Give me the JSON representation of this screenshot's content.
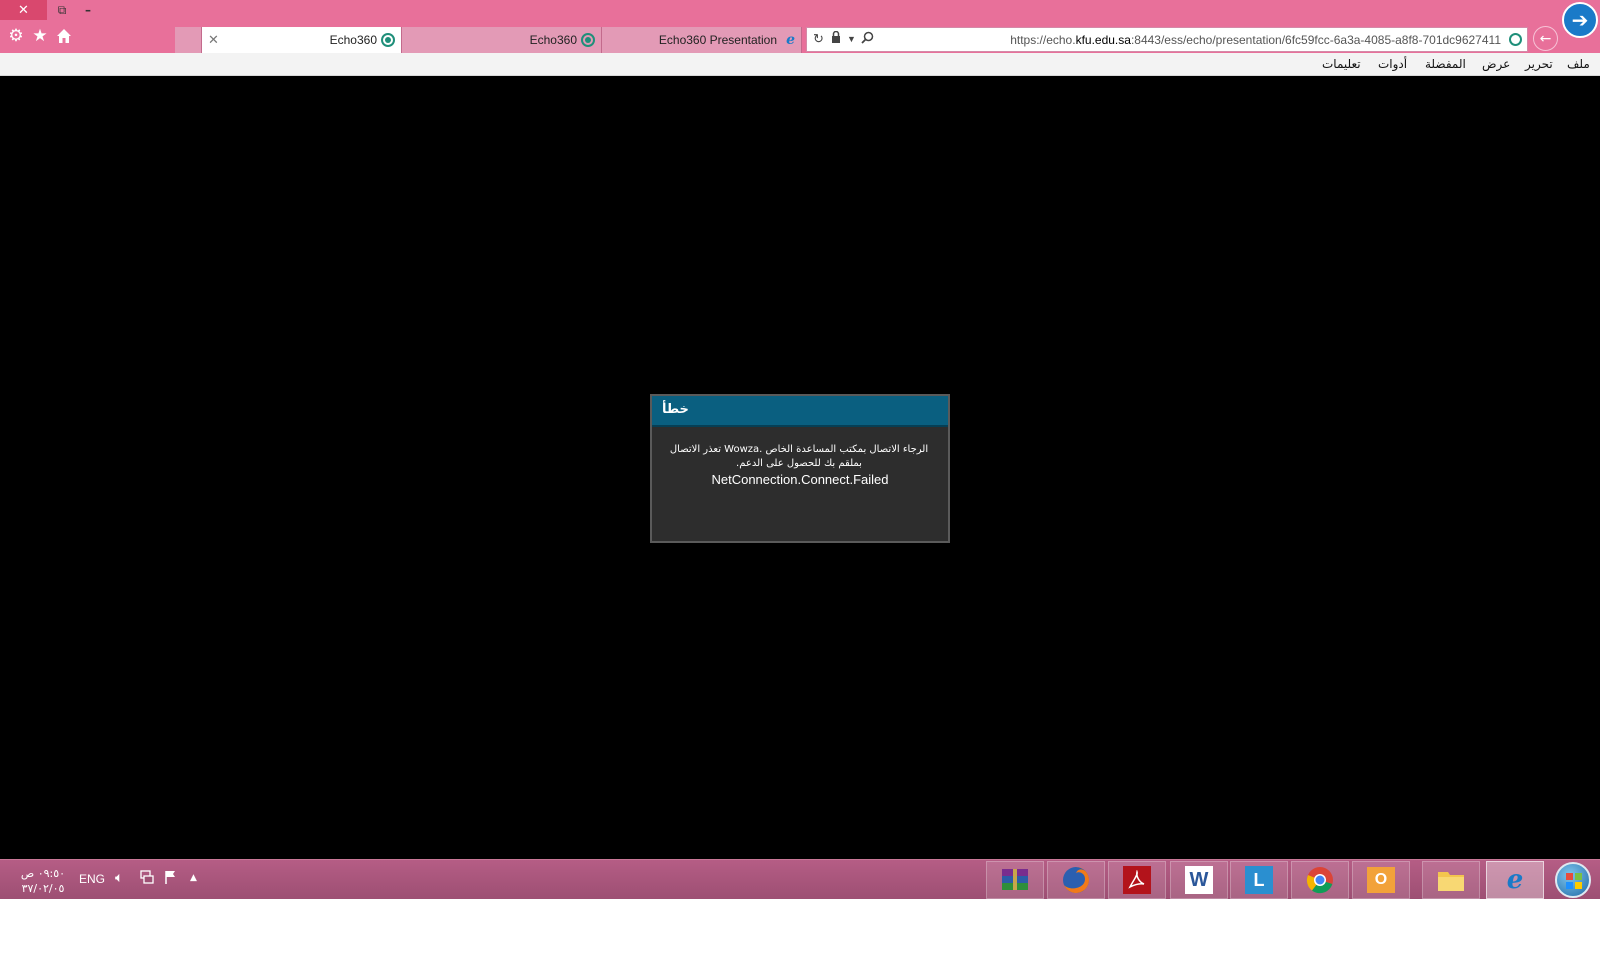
{
  "window": {
    "close_glyph": "✕",
    "restore_glyph": "⧉",
    "minimize_glyph": "–"
  },
  "toolbar": {
    "icons": [
      "gear-icon",
      "star-icon",
      "home-icon"
    ],
    "tabs": [
      {
        "label": "Echo360",
        "active": true
      },
      {
        "label": "Echo360",
        "active": false
      },
      {
        "label": "Echo360 Presentation",
        "active": false
      }
    ],
    "tab_close_glyph": "✕"
  },
  "address_bar": {
    "url_prefix": "https://echo.",
    "url_domain": "kfu.edu.sa",
    "url_path": ":8443/ess/echo/presentation/6fc59fcc-6a3a-4085-a8f8-701dc9627411"
  },
  "nav": {
    "back_glyph": "←",
    "forward_glyph": "➔"
  },
  "menu": [
    "ملف",
    "تحرير",
    "عرض",
    "المفضلة",
    "أدوات",
    "تعليمات"
  ],
  "dialog": {
    "title": "خطأ",
    "message": "الرجاء الاتصال بمكتب المساعدة الخاص .Wowza تعذر الاتصال بملقم بك للحصول على الدعم.",
    "code": "NetConnection.Connect.Failed"
  },
  "taskbar": {
    "clock_time": "٠٩:٥٠ ص",
    "clock_date": "٣٧/٠٢/٠٥",
    "language": "ENG",
    "apps": [
      "winrar",
      "firefox",
      "acrobat",
      "word",
      "lync",
      "chrome",
      "outlook",
      "file-explorer",
      "internet-explorer"
    ]
  },
  "colors": {
    "chrome_pink": "#e8709a",
    "dialog_header": "#0a5f80",
    "ie_blue": "#1a7ac8"
  }
}
